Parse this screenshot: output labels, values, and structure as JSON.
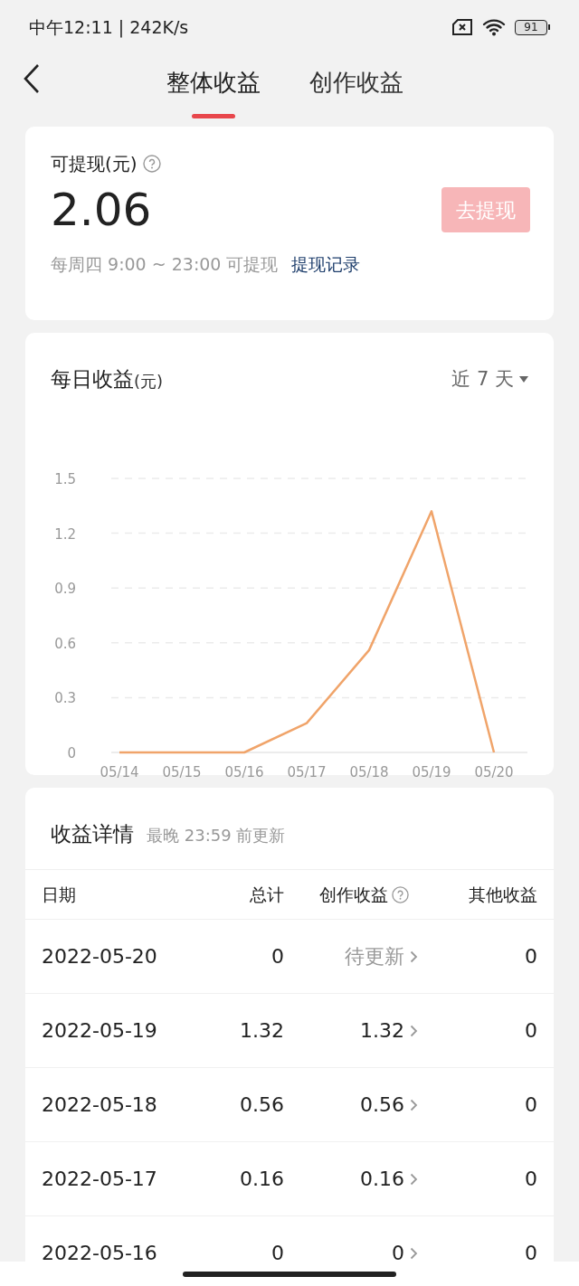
{
  "status_bar": {
    "time": "中午12:11 | 242K/s",
    "battery": "91"
  },
  "tabs": [
    {
      "label": "整体收益",
      "selected": true
    },
    {
      "label": "创作收益",
      "selected": false
    }
  ],
  "balance": {
    "label": "可提现(元)",
    "amount": "2.06",
    "button": "去提现",
    "button_disabled": true,
    "schedule": "每周四 9:00 ~ 23:00 可提现",
    "link": "提现记录"
  },
  "daily": {
    "title": "每日收益",
    "unit": "(元)",
    "range": "近 7 天",
    "chart_data": {
      "type": "line",
      "categories": [
        "05/14",
        "05/15",
        "05/16",
        "05/17",
        "05/18",
        "05/19",
        "05/20"
      ],
      "grid": true,
      "series": [
        {
          "color": "#f0a46a",
          "values": [
            0,
            0,
            0,
            0.16,
            0.56,
            1.32,
            0
          ]
        }
      ],
      "ylim": [
        0,
        1.5
      ],
      "yticks": [
        0,
        0.3,
        0.6,
        0.9,
        1.2,
        1.5
      ]
    }
  },
  "details": {
    "title": "收益详情",
    "note": "最晚 23:59 前更新",
    "columns": [
      "日期",
      "总计",
      "创作收益",
      "其他收益"
    ],
    "rows": [
      {
        "date": "2022-05-20",
        "total": "0",
        "creation": "待更新",
        "pending": true,
        "other": "0"
      },
      {
        "date": "2022-05-19",
        "total": "1.32",
        "creation": "1.32",
        "pending": false,
        "other": "0"
      },
      {
        "date": "2022-05-18",
        "total": "0.56",
        "creation": "0.56",
        "pending": false,
        "other": "0"
      },
      {
        "date": "2022-05-17",
        "total": "0.16",
        "creation": "0.16",
        "pending": false,
        "other": "0"
      },
      {
        "date": "2022-05-16",
        "total": "0",
        "creation": "0",
        "pending": false,
        "other": "0"
      }
    ]
  }
}
